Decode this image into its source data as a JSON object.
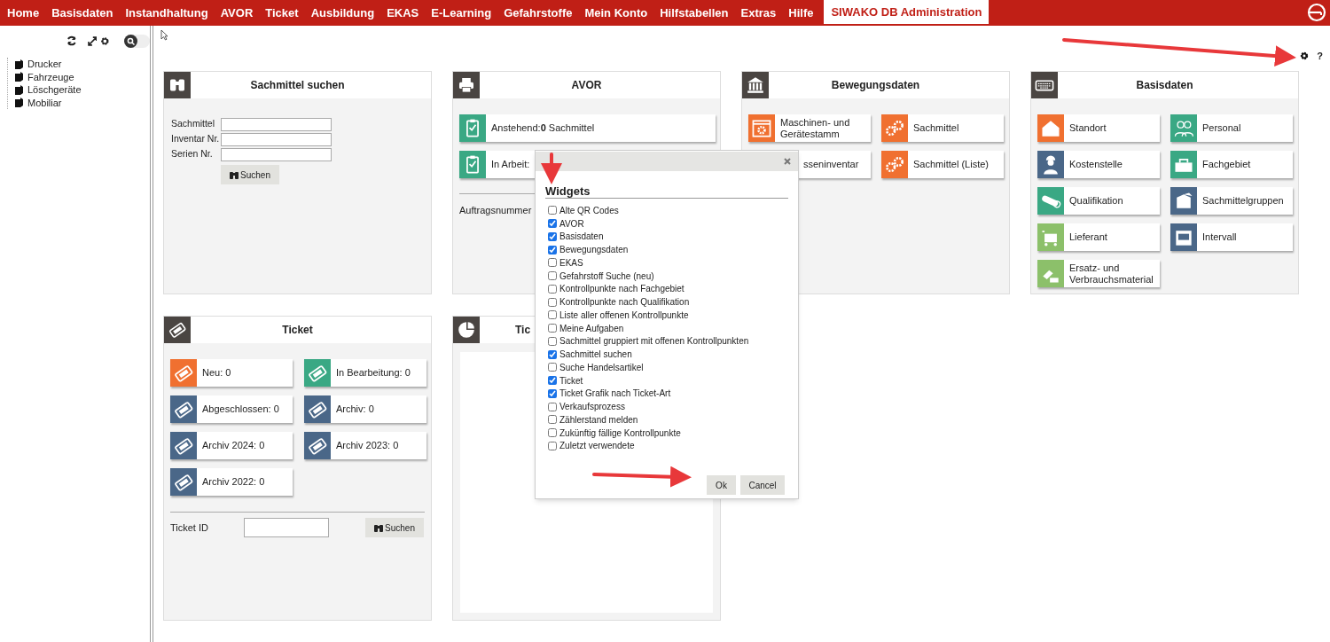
{
  "nav": {
    "items": [
      {
        "label": "Home",
        "selected": false
      },
      {
        "label": "Basisdaten",
        "selected": false
      },
      {
        "label": "Instandhaltung",
        "selected": false
      },
      {
        "label": "AVOR",
        "selected": false
      },
      {
        "label": "Ticket",
        "selected": false
      },
      {
        "label": "Ausbildung",
        "selected": false
      },
      {
        "label": "EKAS",
        "selected": false
      },
      {
        "label": "E-Learning",
        "selected": false
      },
      {
        "label": "Gefahrstoffe",
        "selected": false
      },
      {
        "label": "Mein Konto",
        "selected": false
      },
      {
        "label": "Hilfstabellen",
        "selected": false
      },
      {
        "label": "Extras",
        "selected": false
      },
      {
        "label": "Hilfe",
        "selected": false
      },
      {
        "label": "SIWAKO DB Administration",
        "selected": true
      }
    ]
  },
  "sidebar": {
    "tree": [
      {
        "label": "Drucker"
      },
      {
        "label": "Fahrzeuge"
      },
      {
        "label": "Löschgeräte"
      },
      {
        "label": "Mobiliar"
      }
    ],
    "search_toggle": {
      "on": false
    }
  },
  "toolbar": {
    "help": "?"
  },
  "widgets": [
    {
      "kind": "search",
      "title": "Sachmittel suchen",
      "fields": [
        {
          "label": "Sachmittel"
        },
        {
          "label": "Inventar Nr."
        },
        {
          "label": "Serien Nr."
        }
      ],
      "button": "Suchen"
    },
    {
      "kind": "list",
      "title": "AVOR",
      "tiles": [
        {
          "label": "Anstehend:**0** Sachmittel",
          "color": "#3aa884"
        },
        {
          "label": "In Arbeit:",
          "color": "#3aa884"
        }
      ],
      "footer": "Auftragsnummer"
    },
    {
      "kind": "tiles",
      "title": "Bewegungsdaten",
      "tiles": [
        {
          "label": "Maschinen- und Gerätestamm",
          "color": "#f07030"
        },
        {
          "label": "Sachmittel",
          "color": "#f07030"
        },
        {
          "label": "sseninventar"
        },
        {
          "label": "Sachmittel (Liste)",
          "color": "#f07030"
        }
      ]
    },
    {
      "kind": "tiles",
      "title": "Basisdaten",
      "tiles": [
        {
          "label": "Standort",
          "color": "#f07030"
        },
        {
          "label": "Personal",
          "color": "#3aa884"
        },
        {
          "label": "Kostenstelle",
          "color": "#4a6788"
        },
        {
          "label": "Fachgebiet",
          "color": "#3aa884"
        },
        {
          "label": "Qualifikation",
          "color": "#3aa884"
        },
        {
          "label": "Sachmittelgruppen",
          "color": "#4a6788"
        },
        {
          "label": "Lieferant",
          "color": "#8cc06a"
        },
        {
          "label": "Intervall",
          "color": "#4a6788"
        },
        {
          "label": "Ersatz- und Verbrauchsmaterial",
          "color": "#8cc06a"
        }
      ]
    },
    {
      "kind": "ticket",
      "title": "Ticket",
      "tiles": [
        {
          "label": "Neu: 0",
          "color": "#f07030"
        },
        {
          "label": "In Bearbeitung: 0",
          "color": "#3aa884"
        },
        {
          "label": "Abgeschlossen: 0",
          "color": "#4a6788"
        },
        {
          "label": "Archiv: 0",
          "color": "#4a6788"
        },
        {
          "label": "Archiv 2024: 0",
          "color": "#4a6788"
        },
        {
          "label": "Archiv 2023: 0",
          "color": "#4a6788"
        },
        {
          "label": "Archiv 2022: 0",
          "color": "#4a6788"
        }
      ],
      "field": "Ticket ID",
      "button": "Suchen"
    },
    {
      "kind": "chart",
      "title": "Tic"
    }
  ],
  "dialog": {
    "title": "Widgets",
    "options": [
      {
        "label": "Alte QR Codes",
        "checked": false
      },
      {
        "label": "AVOR",
        "checked": true
      },
      {
        "label": "Basisdaten",
        "checked": true
      },
      {
        "label": "Bewegungsdaten",
        "checked": true
      },
      {
        "label": "EKAS",
        "checked": false
      },
      {
        "label": "Gefahrstoff Suche (neu)",
        "checked": false
      },
      {
        "label": "Kontrollpunkte nach Fachgebiet",
        "checked": false
      },
      {
        "label": "Kontrollpunkte nach Qualifikation",
        "checked": false
      },
      {
        "label": "Liste aller offenen Kontrollpunkte",
        "checked": false
      },
      {
        "label": "Meine Aufgaben",
        "checked": false
      },
      {
        "label": "Sachmittel gruppiert mit offenen Kontrollpunkten",
        "checked": false
      },
      {
        "label": "Sachmittel suchen",
        "checked": true
      },
      {
        "label": "Suche Handelsartikel",
        "checked": false
      },
      {
        "label": "Ticket",
        "checked": true
      },
      {
        "label": "Ticket Grafik nach Ticket-Art",
        "checked": true
      },
      {
        "label": "Verkaufsprozess",
        "checked": false
      },
      {
        "label": "Zählerstand melden",
        "checked": false
      },
      {
        "label": "Zukünftig fällige Kontrollpunkte",
        "checked": false
      },
      {
        "label": "Zuletzt verwendete",
        "checked": false
      }
    ],
    "buttons": [
      "Ok",
      "Cancel"
    ]
  }
}
